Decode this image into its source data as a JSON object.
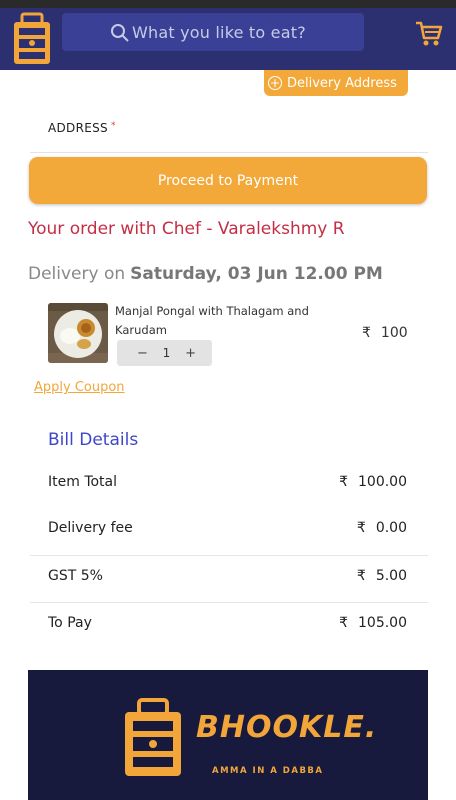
{
  "header": {
    "search_placeholder": "What you like to eat?"
  },
  "address": {
    "delivery_address_button": "Delivery Address",
    "address_label": "ADDRESS",
    "required_mark": "*"
  },
  "checkout": {
    "proceed_button": "Proceed to Payment",
    "order_title": "Your order with Chef - Varalekshmy R",
    "delivery_prefix": "Delivery on",
    "delivery_datetime": "Saturday, 03 Jun 12.00 PM"
  },
  "item": {
    "name": "Manjal Pongal with Thalagam and Karudam",
    "quantity": "1",
    "minus": "−",
    "plus": "+",
    "currency": "₹",
    "price": "100"
  },
  "coupon": {
    "label": "Apply Coupon"
  },
  "bill": {
    "title": "Bill Details",
    "currency": "₹",
    "rows": [
      {
        "label": "Item Total",
        "value": "100.00"
      },
      {
        "label": "Delivery fee",
        "value": "0.00"
      },
      {
        "label": "GST 5%",
        "value": "5.00"
      },
      {
        "label": "To Pay",
        "value": "105.00"
      }
    ]
  },
  "footer": {
    "brand_name": "BHOOKLE.",
    "tagline": "AMMA IN A DABBA"
  },
  "colors": {
    "header_bg": "#2c3070",
    "accent": "#f3a93a",
    "order_title": "#c42e45",
    "bill_title": "#3d47c8",
    "footer_bg": "#171a3c"
  },
  "icons": [
    "logo-icon",
    "search-icon",
    "cart-icon",
    "plus-circle-icon"
  ]
}
